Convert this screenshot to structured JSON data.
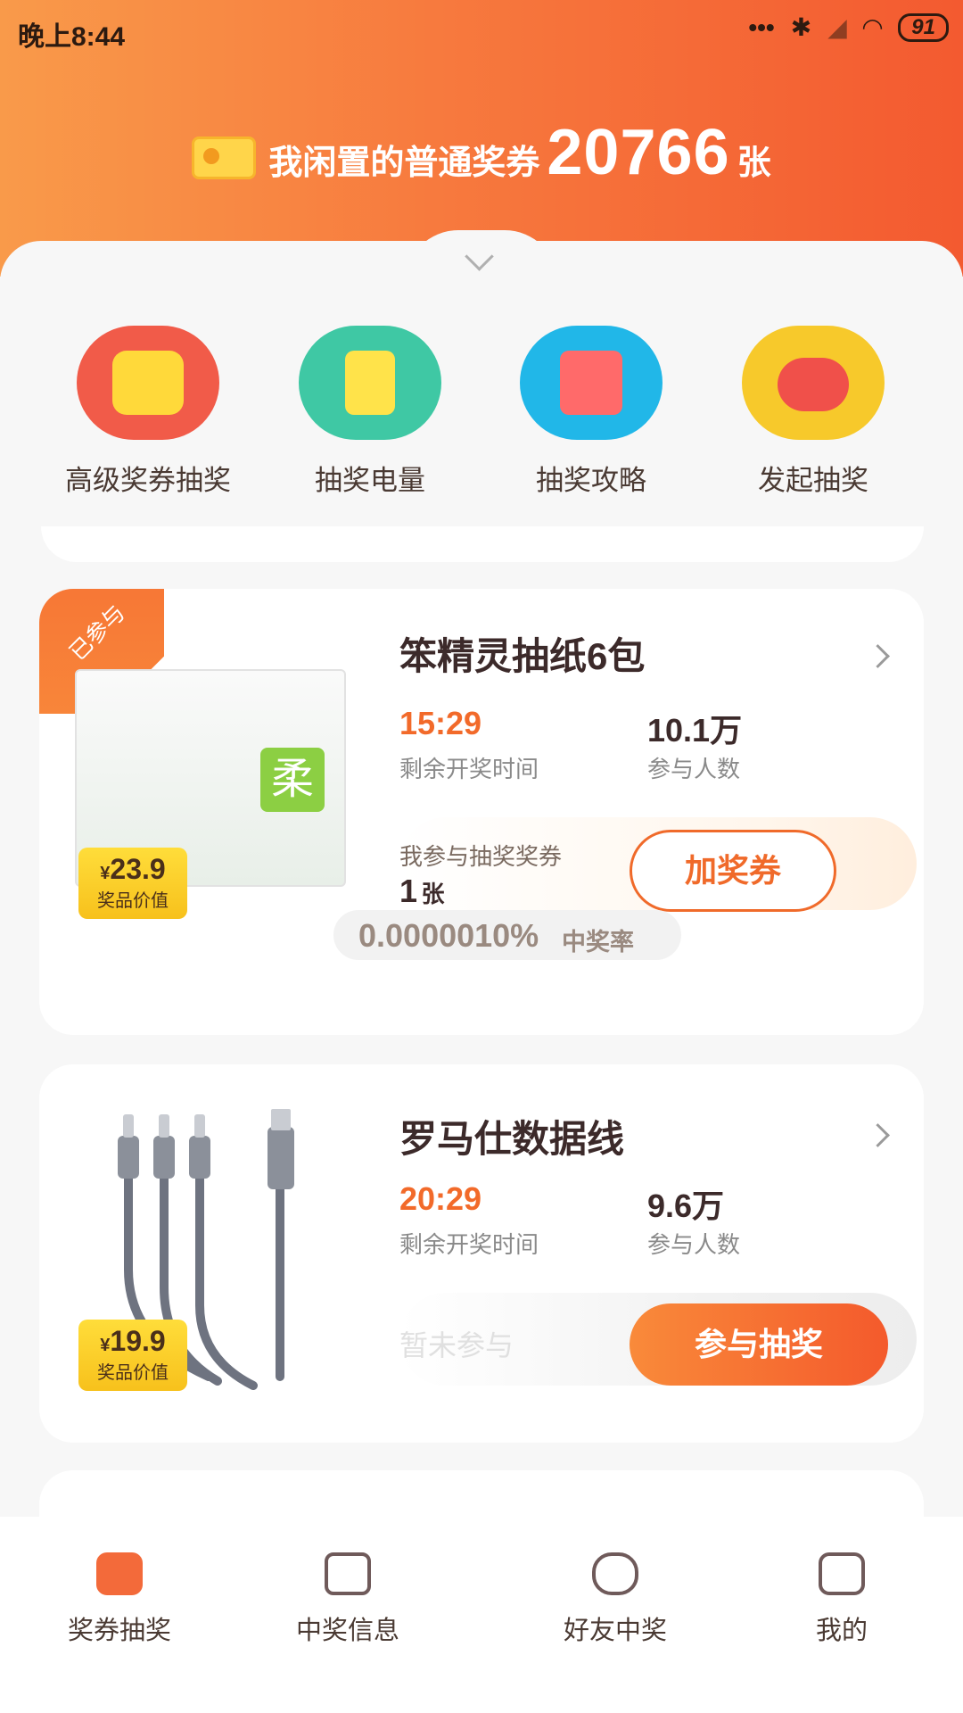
{
  "status_bar": {
    "time": "晚上8:44",
    "battery": "91"
  },
  "header": {
    "label": "我闲置的普通奖券",
    "count": "20766",
    "unit": "张"
  },
  "quick_actions": [
    {
      "label": "高级奖券抽奖"
    },
    {
      "label": "抽奖电量"
    },
    {
      "label": "抽奖攻略"
    },
    {
      "label": "发起抽奖"
    }
  ],
  "cards": [
    {
      "ribbon": "已参与",
      "title": "笨精灵抽纸6包",
      "image_tag": "柔",
      "price": "23.9",
      "currency": "¥",
      "price_label": "奖品价值",
      "time_value": "15:29",
      "time_label": "剩余开奖时间",
      "people_value": "10.1万",
      "people_label": "参与人数",
      "my_tickets_label": "我参与抽奖奖券",
      "my_tickets_count": "1",
      "my_tickets_unit": "张",
      "button": "加奖券",
      "odds_value": "0.0000010%",
      "odds_label": "中奖率"
    },
    {
      "title": "罗马仕数据线",
      "price": "19.9",
      "currency": "¥",
      "price_label": "奖品价值",
      "time_value": "20:29",
      "time_label": "剩余开奖时间",
      "people_value": "9.6万",
      "people_label": "参与人数",
      "status_text": "暂未参与",
      "button": "参与抽奖"
    }
  ],
  "bottom_nav": [
    {
      "label": "奖券抽奖",
      "active": true
    },
    {
      "label": "中奖信息",
      "active": false
    },
    {
      "label": "好友中奖",
      "active": false
    },
    {
      "label": "我的",
      "active": false
    }
  ]
}
